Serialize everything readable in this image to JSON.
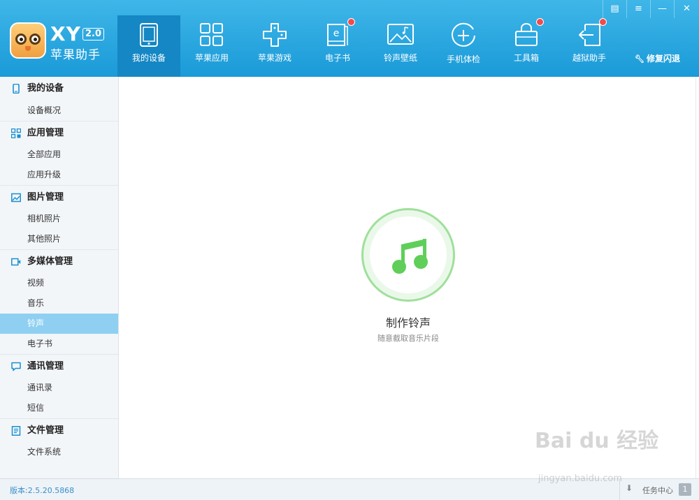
{
  "window": {
    "controls": [
      {
        "name": "skin-button",
        "glyph": "▤"
      },
      {
        "name": "menu-button",
        "glyph": "≡"
      },
      {
        "name": "minimize-button",
        "glyph": "—"
      },
      {
        "name": "close-button",
        "glyph": "✕"
      }
    ]
  },
  "brand": {
    "short": "XY",
    "version": "2.0",
    "name": "苹果助手"
  },
  "nav": {
    "items": [
      {
        "label": "我的设备",
        "icon": "tablet-icon",
        "active": true,
        "badge": false
      },
      {
        "label": "苹果应用",
        "icon": "grid-icon",
        "active": false,
        "badge": false
      },
      {
        "label": "苹果游戏",
        "icon": "gamepad-icon",
        "active": false,
        "badge": false
      },
      {
        "label": "电子书",
        "icon": "ebook-icon",
        "active": false,
        "badge": true
      },
      {
        "label": "铃声壁纸",
        "icon": "wallpaper-icon",
        "active": false,
        "badge": false
      },
      {
        "label": "手机体检",
        "icon": "checkup-icon",
        "active": false,
        "badge": false
      },
      {
        "label": "工具箱",
        "icon": "toolbox-icon",
        "active": false,
        "badge": true
      },
      {
        "label": "越狱助手",
        "icon": "jailbreak-icon",
        "active": false,
        "badge": true
      }
    ],
    "repair_label": "修复闪退"
  },
  "sidebar": {
    "groups": [
      {
        "title": "我的设备",
        "icon": "phone-icon",
        "items": [
          "设备概况"
        ]
      },
      {
        "title": "应用管理",
        "icon": "apps-icon",
        "items": [
          "全部应用",
          "应用升级"
        ]
      },
      {
        "title": "图片管理",
        "icon": "picture-icon",
        "items": [
          "相机照片",
          "其他照片"
        ]
      },
      {
        "title": "多媒体管理",
        "icon": "video-camera-icon",
        "items": [
          "视频",
          "音乐",
          "铃声",
          "电子书"
        ]
      },
      {
        "title": "通讯管理",
        "icon": "chat-icon",
        "items": [
          "通讯录",
          "短信"
        ]
      },
      {
        "title": "文件管理",
        "icon": "file-icon",
        "items": [
          "文件系统"
        ]
      }
    ],
    "active_item": "铃声"
  },
  "main": {
    "action_icon": "music-note-icon",
    "action_title": "制作铃声",
    "action_subtitle": "随意截取音乐片段"
  },
  "status": {
    "version": "版本:2.5.20.5868",
    "task_label": "任务中心",
    "task_count": "1"
  },
  "watermark": {
    "text": "Bai du 经验",
    "url": "jingyan.baidu.com"
  },
  "colors": {
    "header": "#1a9ad8",
    "nav_active": "#1487c4",
    "sidebar_active": "#8fd0f2",
    "accent_green": "#5fcf59",
    "badge_red": "#f44a4a"
  }
}
